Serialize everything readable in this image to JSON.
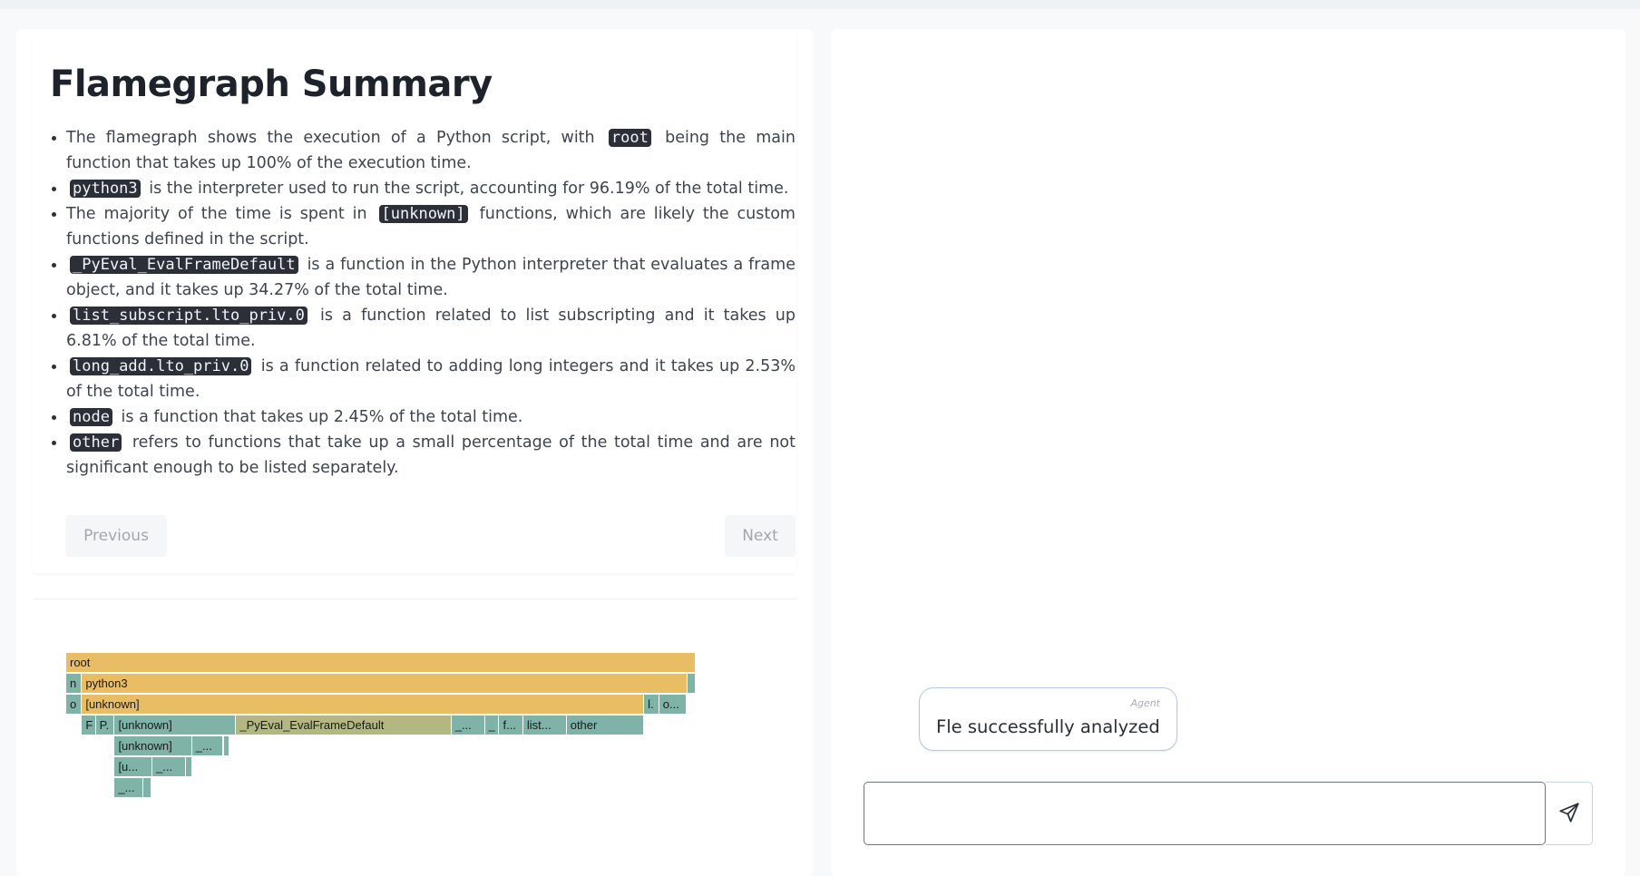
{
  "summary": {
    "title": "Flamegraph Summary",
    "items": [
      {
        "before": "The flamegraph shows the execution of a Python script, with",
        "code": "root",
        "after": "being the main function that takes up 100% of the execution time."
      },
      {
        "before": "",
        "code": "python3",
        "after": "is the interpreter used to run the script, accounting for 96.19% of the total time."
      },
      {
        "before": "The majority of the time is spent in",
        "code": "[unknown]",
        "after": "functions, which are likely the custom functions defined in the script."
      },
      {
        "before": "",
        "code": "_PyEval_EvalFrameDefault",
        "after": "is a function in the Python interpreter that evaluates a frame object, and it takes up 34.27% of the total time."
      },
      {
        "before": "",
        "code": "list_subscript.lto_priv.0",
        "after": "is a function related to list subscripting and it takes up 6.81% of the total time."
      },
      {
        "before": "",
        "code": "long_add.lto_priv.0",
        "after": "is a function related to adding long integers and it takes up 2.53% of the total time."
      },
      {
        "before": "",
        "code": "node",
        "after": "is a function that takes up 2.45% of the total time."
      },
      {
        "before": "",
        "code": "other",
        "after": "refers to functions that take up a small percentage of the total time and are not significant enough to be listed separately."
      }
    ],
    "previous_label": "Previous",
    "next_label": "Next"
  },
  "flamegraph": {
    "frames": [
      {
        "label": "root",
        "depth": 0,
        "start": 0.0,
        "end": 1.0,
        "color": "#e8bd63"
      },
      {
        "label": "n",
        "depth": 1,
        "start": 0.0,
        "end": 0.025,
        "color": "#7fb3a8"
      },
      {
        "label": "python3",
        "depth": 1,
        "start": 0.025,
        "end": 0.987,
        "color": "#e8bd63"
      },
      {
        "label": "",
        "depth": 1,
        "start": 0.987,
        "end": 1.0,
        "color": "#7fb3a8"
      },
      {
        "label": "o",
        "depth": 2,
        "start": 0.0,
        "end": 0.025,
        "color": "#7fb3a8"
      },
      {
        "label": "[unknown]",
        "depth": 2,
        "start": 0.025,
        "end": 0.918,
        "color": "#e8bd63"
      },
      {
        "label": "l.",
        "depth": 2,
        "start": 0.918,
        "end": 0.942,
        "color": "#7fb3a8"
      },
      {
        "label": "o...",
        "depth": 2,
        "start": 0.942,
        "end": 0.985,
        "color": "#7fb3a8"
      },
      {
        "label": "F",
        "depth": 3,
        "start": 0.025,
        "end": 0.047,
        "color": "#7fb3a8"
      },
      {
        "label": "P.",
        "depth": 3,
        "start": 0.047,
        "end": 0.077,
        "color": "#7fb3a8"
      },
      {
        "label": "[unknown]",
        "depth": 3,
        "start": 0.077,
        "end": 0.27,
        "color": "#7fb3a8"
      },
      {
        "label": "_PyEval_EvalFrameDefault",
        "depth": 3,
        "start": 0.27,
        "end": 0.612,
        "color": "#b3b882"
      },
      {
        "label": "_...",
        "depth": 3,
        "start": 0.612,
        "end": 0.665,
        "color": "#7fb3a8"
      },
      {
        "label": "_",
        "depth": 3,
        "start": 0.665,
        "end": 0.688,
        "color": "#7fb3a8"
      },
      {
        "label": "f...",
        "depth": 3,
        "start": 0.688,
        "end": 0.726,
        "color": "#7fb3a8"
      },
      {
        "label": "list...",
        "depth": 3,
        "start": 0.726,
        "end": 0.795,
        "color": "#7fb3a8"
      },
      {
        "label": "other",
        "depth": 3,
        "start": 0.795,
        "end": 0.918,
        "color": "#7fb3a8"
      },
      {
        "label": "[unknown]",
        "depth": 4,
        "start": 0.077,
        "end": 0.2,
        "color": "#7fb3a8"
      },
      {
        "label": "_...",
        "depth": 4,
        "start": 0.2,
        "end": 0.25,
        "color": "#7fb3a8"
      },
      {
        "label": "",
        "depth": 4,
        "start": 0.25,
        "end": 0.26,
        "color": "#7fb3a8"
      },
      {
        "label": "[u...",
        "depth": 5,
        "start": 0.077,
        "end": 0.137,
        "color": "#7fb3a8"
      },
      {
        "label": "_...",
        "depth": 5,
        "start": 0.137,
        "end": 0.19,
        "color": "#7fb3a8"
      },
      {
        "label": "",
        "depth": 5,
        "start": 0.19,
        "end": 0.2,
        "color": "#7fb3a8"
      },
      {
        "label": "_...",
        "depth": 6,
        "start": 0.077,
        "end": 0.123,
        "color": "#7fb3a8"
      },
      {
        "label": "",
        "depth": 6,
        "start": 0.123,
        "end": 0.135,
        "color": "#7fb3a8"
      }
    ]
  },
  "chat": {
    "messages": [
      {
        "role": "Agent",
        "text": "Fle successfully analyzed"
      }
    ],
    "input_value": "",
    "input_placeholder": "",
    "send_icon": "send-icon"
  },
  "colors": {
    "background": "#f7f9fb",
    "code_bg": "#2a2f38",
    "flame_yellow": "#e8bd63",
    "flame_teal": "#7fb3a8",
    "flame_olive": "#b3b882",
    "bubble_border": "#b7c8e0"
  }
}
